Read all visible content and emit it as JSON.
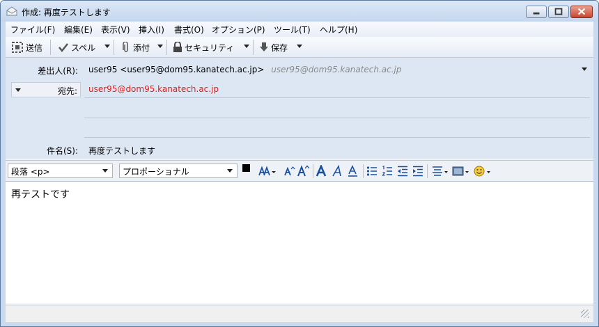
{
  "window": {
    "title": "作成: 再度テストします"
  },
  "menu": [
    "ファイル(F)",
    "編集(E)",
    "表示(V)",
    "挿入(I)",
    "書式(O)",
    "オプション(P)",
    "ツール(T)",
    "ヘルプ(H)"
  ],
  "toolbar": {
    "send": "送信",
    "spell": "スペル",
    "attach": "添付",
    "security": "セキュリティ",
    "save": "保存"
  },
  "headers": {
    "from_label": "差出人(R):",
    "from_value": "user95 <user95@dom95.kanatech.ac.jp>",
    "from_hint": "user95@dom95.kanatech.ac.jp",
    "to_label": "宛先:",
    "to_value": "user95@dom95.kanatech.ac.jp",
    "subject_label": "件名(S):",
    "subject_value": "再度テストします"
  },
  "format": {
    "paragraph": "段落 <p>",
    "font": "プロポーショナル"
  },
  "body": {
    "text": "再テストです"
  },
  "colors": {
    "recipient": "#e0201a",
    "format_icon": "#1a4fa0"
  }
}
